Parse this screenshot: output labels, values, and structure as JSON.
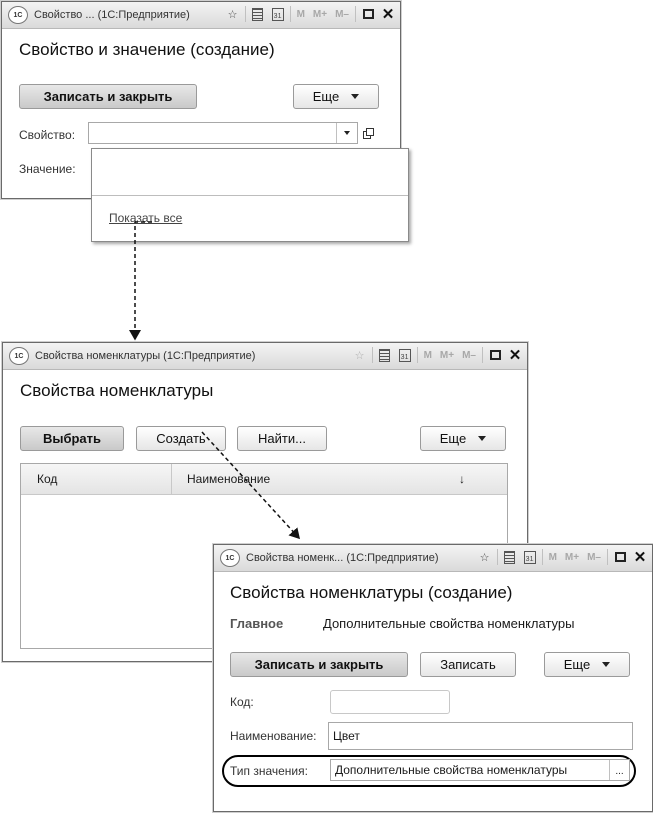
{
  "window1": {
    "title": "Свойство ... (1С:Предприятие)",
    "heading": "Свойство и значение (создание)",
    "save_close": "Записать и закрыть",
    "more": "Еще",
    "property_label": "Свойство:",
    "value_label": "Значение:",
    "show_all": "Показать все",
    "m_buttons": [
      "M",
      "M+",
      "M–"
    ],
    "logo": "1С",
    "calendar_day": "31"
  },
  "window2": {
    "title": "Свойства номенклатуры (1С:Предприятие)",
    "heading": "Свойства номенклатуры",
    "select": "Выбрать",
    "create": "Создать",
    "find": "Найти...",
    "more": "Еще",
    "col_code": "Код",
    "col_name": "Наименование",
    "sort_arrow": "↓",
    "m_buttons": [
      "M",
      "M+",
      "M–"
    ],
    "logo": "1С",
    "calendar_day": "31"
  },
  "window3": {
    "title": "Свойства номенк... (1С:Предприятие)",
    "heading": "Свойства номенклатуры (создание)",
    "tab_main": "Главное",
    "tab_extra": "Дополнительные свойства номенклатуры",
    "save_close": "Записать и закрыть",
    "save": "Записать",
    "more": "Еще",
    "code_label": "Код:",
    "name_label": "Наименование:",
    "name_value": "Цвет",
    "type_label": "Тип значения:",
    "type_value": "Дополнительные свойства номенклатуры",
    "ellipsis": "...",
    "m_buttons": [
      "M",
      "M+",
      "M–"
    ],
    "logo": "1С",
    "calendar_day": "31"
  }
}
